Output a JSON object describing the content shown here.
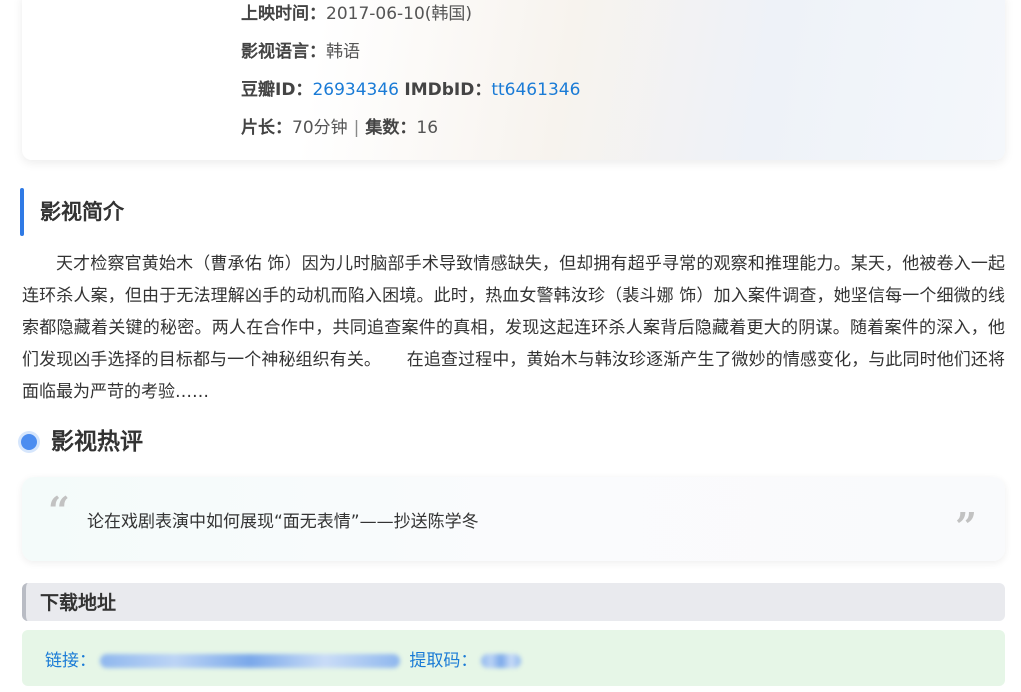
{
  "info": {
    "release_label": "上映时间：",
    "release_value": "2017-06-10(韩国)",
    "language_label": "影视语言：",
    "language_value": "韩语",
    "douban_label": "豆瓣ID：",
    "douban_value": "26934346",
    "imdb_label": "IMDbID：",
    "imdb_value": "tt6461346",
    "length_label": "片长：",
    "length_value": "70分钟",
    "separator": "|",
    "episodes_label": "集数：",
    "episodes_value": "16"
  },
  "synopsis": {
    "title": "影视简介",
    "text": "天才检察官黄始木（曹承佑 饰）因为儿时脑部手术导致情感缺失，但却拥有超乎寻常的观察和推理能力。某天，他被卷入一起连环杀人案，但由于无法理解凶手的动机而陷入困境。此时，热血女警韩汝珍（裴斗娜 饰）加入案件调查，她坚信每一个细微的线索都隐藏着关键的秘密。两人在合作中，共同追查案件的真相，发现这起连环杀人案背后隐藏着更大的阴谋。随着案件的深入，他们发现凶手选择的目标都与一个神秘组织有关。　　在追查过程中，黄始木与韩汝珍逐渐产生了微妙的情感变化，与此同时他们还将面临最为严苛的考验……"
  },
  "reviews": {
    "title": "影视热评",
    "quote_open": "“",
    "quote_close": "”",
    "text": "论在戏剧表演中如何展现“面无表情”——抄送陈学冬"
  },
  "download": {
    "title": "下载地址",
    "link_label": "链接：",
    "code_label": "提取码："
  },
  "colors": {
    "accent": "#2f7ae5",
    "link": "#1a7bd6",
    "download_bg": "#e6f6e7"
  }
}
